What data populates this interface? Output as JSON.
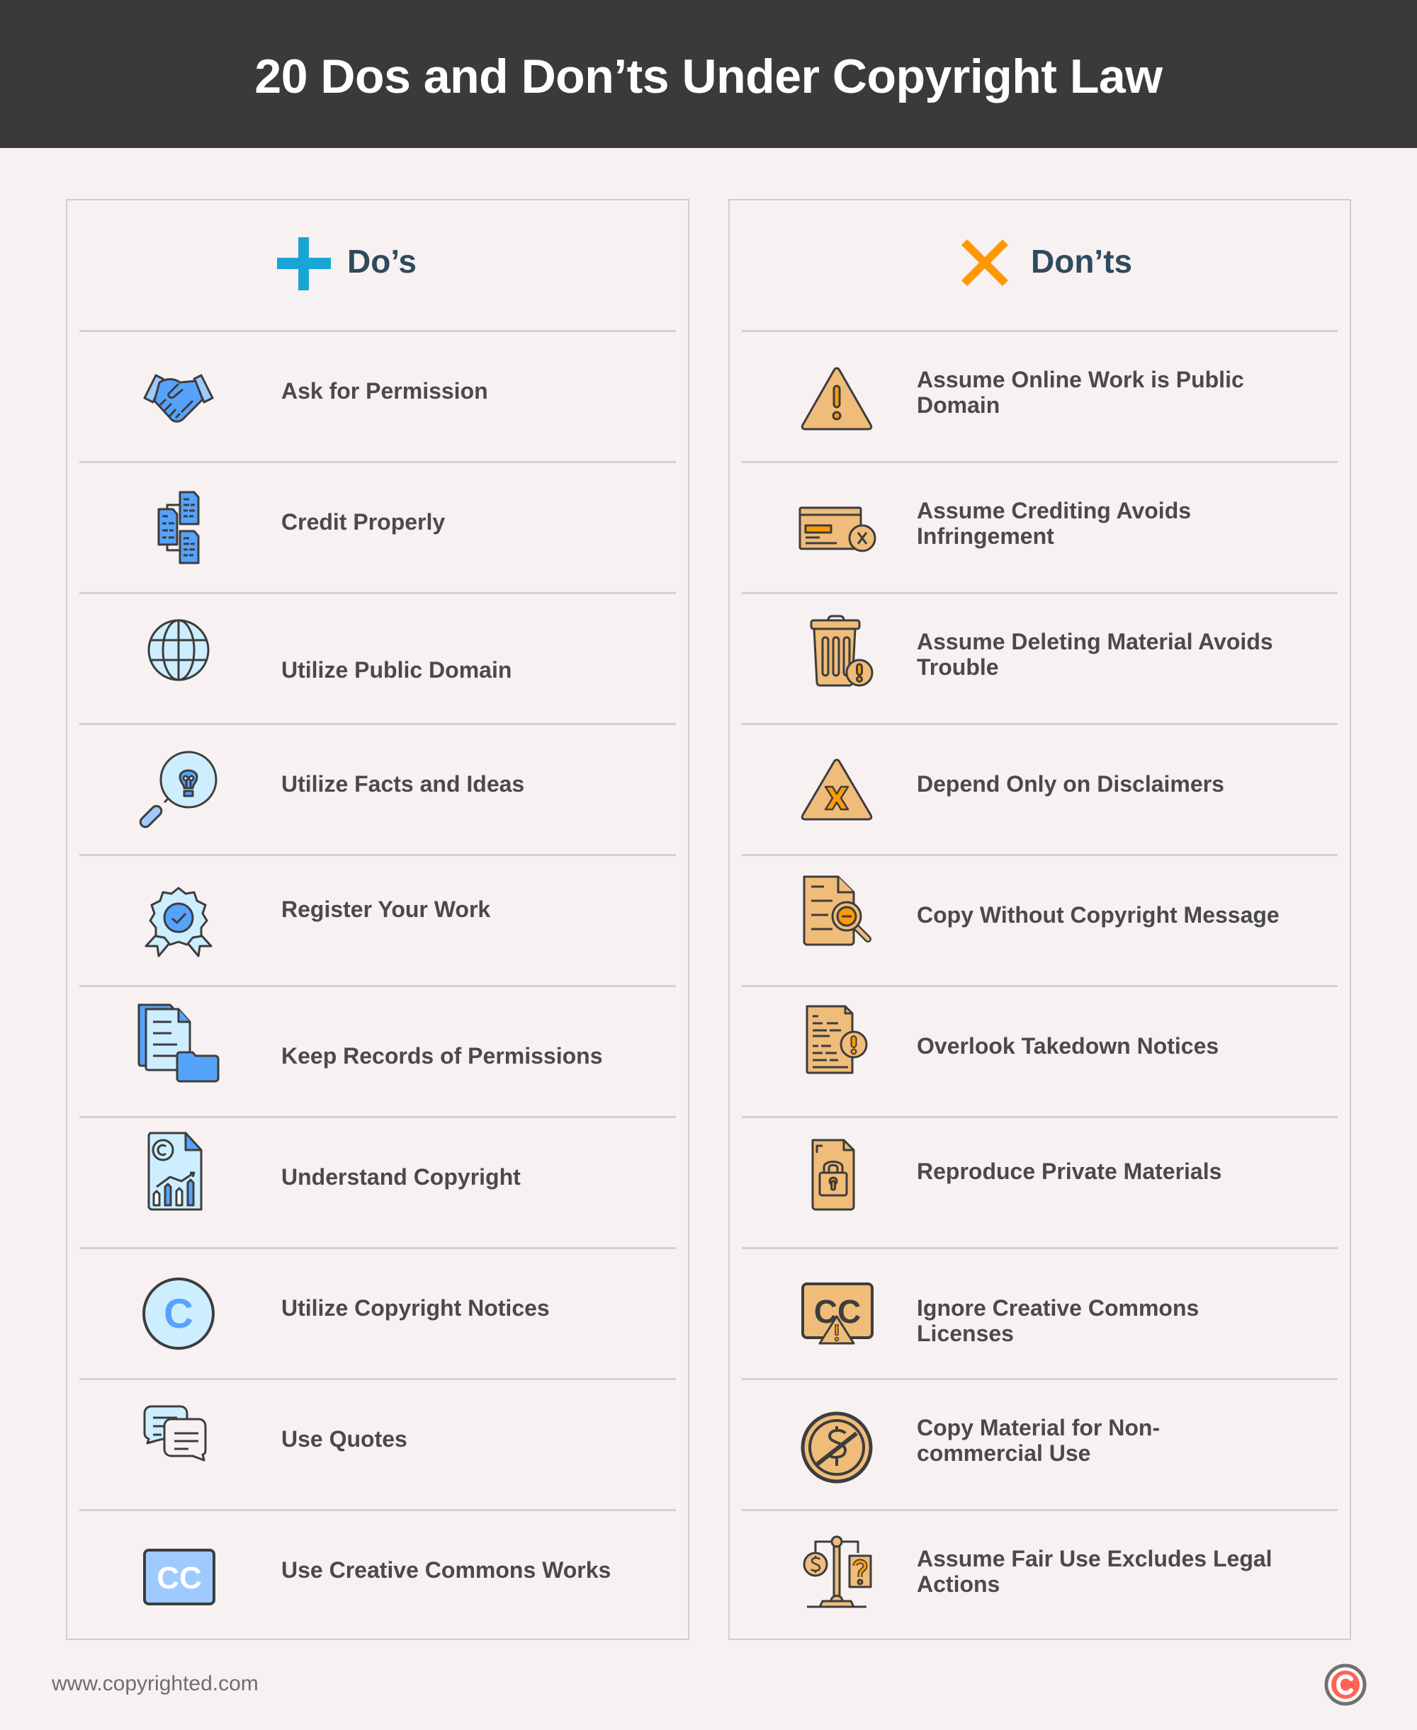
{
  "header": {
    "title": "20 Dos and Don’ts Under Copyright Law"
  },
  "colors": {
    "header_bg": "#3c3a38",
    "page_bg": "#f7f1f1",
    "dos_accent": "#1aa6d4",
    "donts_accent": "#ff9800",
    "heading_text": "#2f4a5e",
    "item_text": "#4a4a4a",
    "blue_light": "#cdeeff",
    "blue_mid": "#9ecaff",
    "blue_dark": "#56a3fb",
    "tan": "#f0bc7a",
    "orange": "#ff9a00",
    "logo_red": "#ff6257"
  },
  "dos": {
    "heading": "Do’s",
    "icon": "plus-icon",
    "items": [
      {
        "label": "Ask for Permission",
        "icon": "handshake-icon"
      },
      {
        "label": "Credit Properly",
        "icon": "linked-documents-icon"
      },
      {
        "label": "Utilize Public Domain",
        "icon": "globe-icon"
      },
      {
        "label": "Utilize Facts and Ideas",
        "icon": "lightbulb-magnifier-icon"
      },
      {
        "label": "Register Your Work",
        "icon": "award-badge-icon"
      },
      {
        "label": "Keep Records of Permissions",
        "icon": "document-folder-icon"
      },
      {
        "label": "Understand Copyright",
        "icon": "copyright-report-icon"
      },
      {
        "label": "Utilize Copyright Notices",
        "icon": "copyright-circle-icon"
      },
      {
        "label": "Use Quotes",
        "icon": "speech-bubbles-icon"
      },
      {
        "label": "Use Creative Commons Works",
        "icon": "cc-badge-icon",
        "icon_text": "CC"
      }
    ]
  },
  "donts": {
    "heading": "Don’ts",
    "icon": "x-icon",
    "items": [
      {
        "label": "Assume Online Work is Public Domain",
        "icon": "warning-triangle-icon"
      },
      {
        "label": "Assume Crediting Avoids Infringement",
        "icon": "credit-card-x-icon"
      },
      {
        "label": "Assume Deleting Material Avoids Trouble",
        "icon": "trash-warning-icon"
      },
      {
        "label": "Depend Only on Disclaimers",
        "icon": "triangle-x-icon"
      },
      {
        "label": "Copy Without Copyright Message",
        "icon": "document-search-icon"
      },
      {
        "label": "Overlook Takedown Notices",
        "icon": "document-alert-icon"
      },
      {
        "label": "Reproduce Private Materials",
        "icon": "locked-document-icon"
      },
      {
        "label": "Ignore Creative Commons Licenses",
        "icon": "cc-warning-icon",
        "icon_text": "CC"
      },
      {
        "label": "Copy Material for Non-commercial Use",
        "icon": "no-dollar-icon"
      },
      {
        "label": "Assume Fair Use Excludes Legal Actions",
        "icon": "scale-dollar-question-icon"
      }
    ]
  },
  "footer": {
    "url": "www.copyrighted.com",
    "logo": "copyrighted-logo-icon"
  }
}
